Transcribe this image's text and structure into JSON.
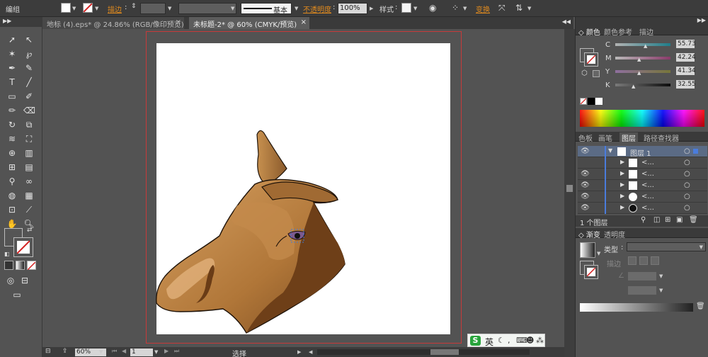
{
  "control_bar": {
    "selection_label": "编组",
    "stroke_label": "描边",
    "brush_label": "基本",
    "opacity_label": "不透明度",
    "opacity_value": "100%",
    "style_label": "样式",
    "transform_label": "变换"
  },
  "doc_tabs": [
    {
      "label": "地标 (4).eps* @ 24.86% (RGB/像印预览)"
    },
    {
      "label": "未标题-2* @ 60% (CMYK/预览)"
    }
  ],
  "color_panel": {
    "tabs": [
      "颜色",
      "颜色参考",
      "描边"
    ],
    "channels": [
      {
        "name": "C",
        "value": "55.73"
      },
      {
        "name": "M",
        "value": "42.24"
      },
      {
        "name": "Y",
        "value": "41.34"
      },
      {
        "name": "K",
        "value": "32.55"
      }
    ]
  },
  "layers_panel": {
    "tabs": [
      "色板",
      "画笔",
      "图层",
      "路径查找器"
    ],
    "top_layer_name": "图层 1",
    "sublayer_name": "<...",
    "footer": "1 个图层"
  },
  "gradient_panel": {
    "tabs": [
      "渐变",
      "透明度"
    ],
    "type_label": "类型",
    "stroke_label": "描边"
  },
  "status_bar": {
    "zoom": "60%",
    "page": "1",
    "mode": "选择"
  },
  "ime": {
    "label": "英"
  },
  "accent_colors": {
    "artboard_border": "#c83a3a",
    "orange_labels": "#e08a1e",
    "layer_color": "#4a7cdc"
  }
}
